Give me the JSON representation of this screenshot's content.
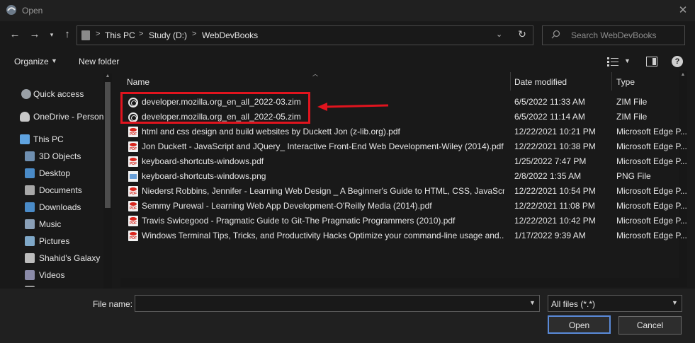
{
  "window": {
    "title": "Open",
    "close_glyph": "✕"
  },
  "address": {
    "breadcrumbs": [
      "This PC",
      "Study (D:)",
      "WebDevBooks"
    ],
    "separator": ">",
    "search_placeholder": "Search WebDevBooks"
  },
  "toolbar": {
    "organize_label": "Organize",
    "new_folder_label": "New folder"
  },
  "nav": {
    "items": [
      {
        "label": "Quick access",
        "icon": "star-icon"
      },
      {
        "label": "OneDrive - Person",
        "icon": "cloud-icon"
      },
      {
        "label": "This PC",
        "icon": "computer-icon"
      },
      {
        "label": "3D Objects",
        "icon": "cube-icon"
      },
      {
        "label": "Desktop",
        "icon": "desktop-icon"
      },
      {
        "label": "Documents",
        "icon": "document-icon"
      },
      {
        "label": "Downloads",
        "icon": "download-icon"
      },
      {
        "label": "Music",
        "icon": "music-icon"
      },
      {
        "label": "Pictures",
        "icon": "picture-icon"
      },
      {
        "label": "Shahid's Galaxy",
        "icon": "phone-icon"
      },
      {
        "label": "Videos",
        "icon": "video-icon"
      },
      {
        "label": "Windows (C:)",
        "icon": "drive-icon"
      }
    ]
  },
  "columns": {
    "name": "Name",
    "date": "Date modified",
    "type": "Type"
  },
  "files": [
    {
      "name": "developer.mozilla.org_en_all_2022-03.zim",
      "date": "6/5/2022 11:33 AM",
      "type": "ZIM File",
      "icon": "zim"
    },
    {
      "name": "developer.mozilla.org_en_all_2022-05.zim",
      "date": "6/5/2022 11:14 AM",
      "type": "ZIM File",
      "icon": "zim"
    },
    {
      "name": "html and css design and build websites by Duckett Jon (z-lib.org).pdf",
      "date": "12/22/2021 10:21 PM",
      "type": "Microsoft Edge P...",
      "icon": "pdf"
    },
    {
      "name": "Jon Duckett - JavaScript and JQuery_ Interactive Front-End Web Development-Wiley (2014).pdf",
      "date": "12/22/2021 10:38 PM",
      "type": "Microsoft Edge P...",
      "icon": "pdf"
    },
    {
      "name": "keyboard-shortcuts-windows.pdf",
      "date": "1/25/2022 7:47 PM",
      "type": "Microsoft Edge P...",
      "icon": "pdf"
    },
    {
      "name": "keyboard-shortcuts-windows.png",
      "date": "2/8/2022 1:35 AM",
      "type": "PNG File",
      "icon": "png"
    },
    {
      "name": "Niederst Robbins, Jennifer - Learning Web Design _ A Beginner's Guide to HTML, CSS, JavaScrip...",
      "date": "12/22/2021 10:54 PM",
      "type": "Microsoft Edge P...",
      "icon": "pdf"
    },
    {
      "name": "Semmy Purewal - Learning Web App Development-O'Reilly Media (2014).pdf",
      "date": "12/22/2021 11:08 PM",
      "type": "Microsoft Edge P...",
      "icon": "pdf"
    },
    {
      "name": "Travis Swicegood - Pragmatic Guide to Git-The Pragmatic Programmers (2010).pdf",
      "date": "12/22/2021 10:42 PM",
      "type": "Microsoft Edge P...",
      "icon": "pdf"
    },
    {
      "name": "Windows Terminal Tips, Tricks, and Productivity Hacks Optimize your command-line usage and...",
      "date": "1/17/2022 9:39 AM",
      "type": "Microsoft Edge P...",
      "icon": "pdf"
    }
  ],
  "bottom": {
    "file_name_label": "File name:",
    "file_name_value": "",
    "filter_value": "All files (*.*)",
    "open_label": "Open",
    "cancel_label": "Cancel"
  },
  "colors": {
    "highlight": "#e0141e",
    "accent": "#5a8ad8"
  }
}
